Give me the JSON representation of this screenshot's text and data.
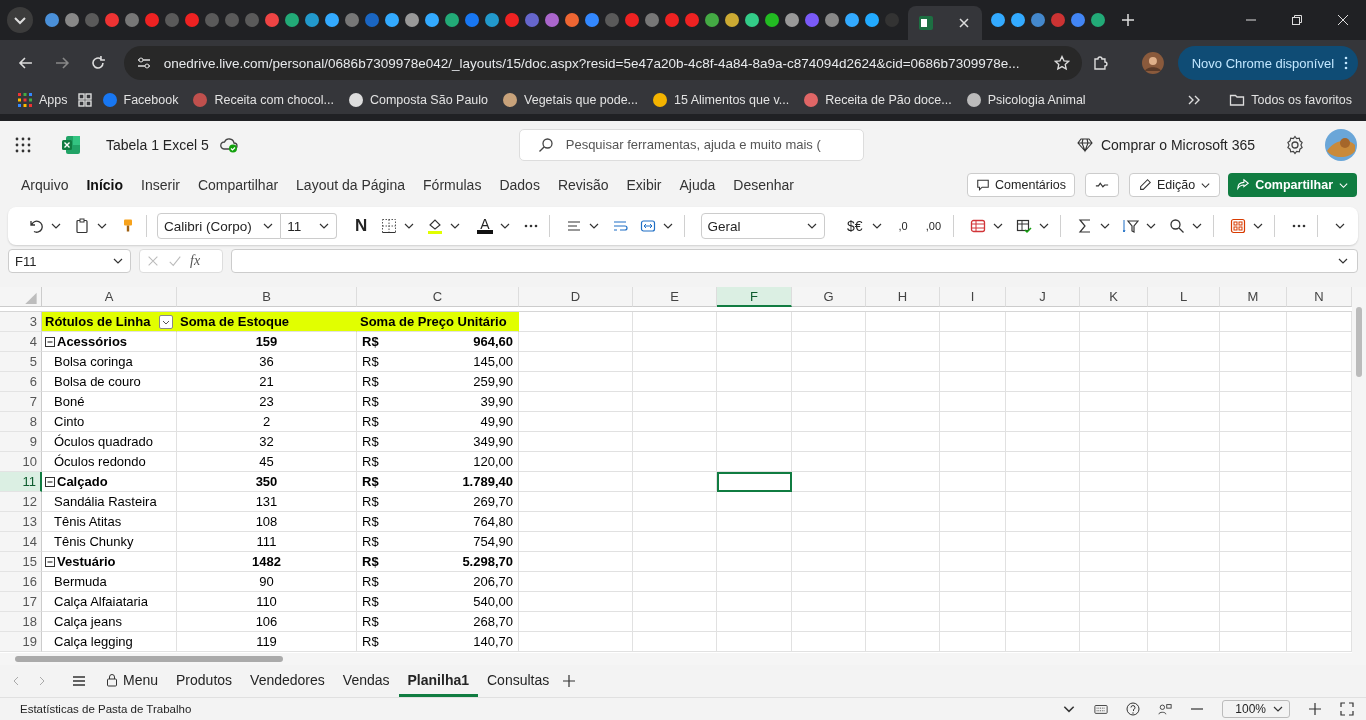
{
  "browser": {
    "address": "onedrive.live.com/personal/0686b7309978e042/_layouts/15/doc.aspx?resid=5e47a20b-4c8f-4a84-8a9a-c874094d2624&cid=0686b7309978e...",
    "update_button": "Novo Chrome disponível",
    "bookmarks": [
      {
        "label": "Facebook",
        "color": "#1877f2"
      },
      {
        "label": "Receita com chocol...",
        "color": "#c0504d"
      },
      {
        "label": "Composta São Paulo",
        "color": "#dddddd"
      },
      {
        "label": "Vegetais que pode...",
        "color": "#c8a27a"
      },
      {
        "label": "15 Alimentos que v...",
        "color": "#f4b400"
      },
      {
        "label": "Receita de Pão doce...",
        "color": "#e06666"
      },
      {
        "label": "Psicologia Animal",
        "color": "#bbbbbb"
      }
    ],
    "apps_label": "Apps",
    "all_bookmarks": "Todos os favoritos"
  },
  "app": {
    "title": "Tabela 1 Excel 5",
    "search_placeholder": "Pesquisar ferramentas, ajuda e muito mais (",
    "buy_label": "Comprar o Microsoft 365"
  },
  "menu": [
    {
      "label": "Arquivo",
      "selected": false
    },
    {
      "label": "Início",
      "selected": true
    },
    {
      "label": "Inserir",
      "selected": false
    },
    {
      "label": "Compartilhar",
      "selected": false
    },
    {
      "label": "Layout da Página",
      "selected": false
    },
    {
      "label": "Fórmulas",
      "selected": false
    },
    {
      "label": "Dados",
      "selected": false
    },
    {
      "label": "Revisão",
      "selected": false
    },
    {
      "label": "Exibir",
      "selected": false
    },
    {
      "label": "Ajuda",
      "selected": false
    },
    {
      "label": "Desenhar",
      "selected": false
    }
  ],
  "actions": {
    "comments": "Comentários",
    "editing": "Edição",
    "share": "Compartilhar"
  },
  "ribbon": {
    "font": "Calibri (Corpo)",
    "size": "11",
    "bold": "N",
    "font_color_letter": "A",
    "number_format": "Geral",
    "currency": "$€",
    "decrease_decimal": ",0",
    "increase_decimal": ",00"
  },
  "formula_bar": {
    "name_box": "F11",
    "function_label": "fx"
  },
  "sheet": {
    "columns": [
      {
        "label": "A",
        "selected": false
      },
      {
        "label": "B",
        "selected": false
      },
      {
        "label": "C",
        "selected": false
      },
      {
        "label": "D",
        "selected": false
      },
      {
        "label": "E",
        "selected": false
      },
      {
        "label": "F",
        "selected": true
      },
      {
        "label": "G",
        "selected": false
      },
      {
        "label": "H",
        "selected": false
      },
      {
        "label": "I",
        "selected": false
      },
      {
        "label": "J",
        "selected": false
      },
      {
        "label": "K",
        "selected": false
      },
      {
        "label": "L",
        "selected": false
      },
      {
        "label": "M",
        "selected": false
      },
      {
        "label": "N",
        "selected": false
      }
    ],
    "rows": [
      {
        "number": "3",
        "kind": "header",
        "selected": false,
        "label": "Rótulos de Linha",
        "stock": "Soma de Estoque",
        "price": "Soma de Preço Unitário"
      },
      {
        "number": "4",
        "kind": "group",
        "selected": false,
        "expanded": true,
        "label": "Acessórios",
        "stock": "159",
        "currency": "R$",
        "price": "964,60"
      },
      {
        "number": "5",
        "kind": "item",
        "selected": false,
        "label": "Bolsa coringa",
        "stock": "36",
        "currency": "R$",
        "price": "145,00"
      },
      {
        "number": "6",
        "kind": "item",
        "selected": false,
        "label": "Bolsa de couro",
        "stock": "21",
        "currency": "R$",
        "price": "259,90"
      },
      {
        "number": "7",
        "kind": "item",
        "selected": false,
        "label": "Boné",
        "stock": "23",
        "currency": "R$",
        "price": "39,90"
      },
      {
        "number": "8",
        "kind": "item",
        "selected": false,
        "label": "Cinto",
        "stock": "2",
        "currency": "R$",
        "price": "49,90"
      },
      {
        "number": "9",
        "kind": "item",
        "selected": false,
        "label": "Óculos quadrado",
        "stock": "32",
        "currency": "R$",
        "price": "349,90"
      },
      {
        "number": "10",
        "kind": "item",
        "selected": false,
        "label": "Óculos redondo",
        "stock": "45",
        "currency": "R$",
        "price": "120,00"
      },
      {
        "number": "11",
        "kind": "group",
        "selected": true,
        "expanded": true,
        "label": "Calçado",
        "stock": "350",
        "currency": "R$",
        "price": "1.789,40"
      },
      {
        "number": "12",
        "kind": "item",
        "selected": false,
        "label": "Sandália Rasteira",
        "stock": "131",
        "currency": "R$",
        "price": "269,70"
      },
      {
        "number": "13",
        "kind": "item",
        "selected": false,
        "label": "Tênis Atitas",
        "stock": "108",
        "currency": "R$",
        "price": "764,80"
      },
      {
        "number": "14",
        "kind": "item",
        "selected": false,
        "label": "Tênis Chunky",
        "stock": "111",
        "currency": "R$",
        "price": "754,90"
      },
      {
        "number": "15",
        "kind": "group",
        "selected": false,
        "expanded": true,
        "label": "Vestuário",
        "stock": "1482",
        "currency": "R$",
        "price": "5.298,70"
      },
      {
        "number": "16",
        "kind": "item",
        "selected": false,
        "label": "Bermuda",
        "stock": "90",
        "currency": "R$",
        "price": "206,70"
      },
      {
        "number": "17",
        "kind": "item",
        "selected": false,
        "label": "Calça Alfaiataria",
        "stock": "110",
        "currency": "R$",
        "price": "540,00"
      },
      {
        "number": "18",
        "kind": "item",
        "selected": false,
        "label": "Calça jeans",
        "stock": "106",
        "currency": "R$",
        "price": "268,70"
      },
      {
        "number": "19",
        "kind": "item",
        "selected": false,
        "label": "Calça legging",
        "stock": "119",
        "currency": "R$",
        "price": "140,70"
      }
    ]
  },
  "sheet_tabs": [
    {
      "label": "Menu",
      "kind": "locked",
      "selected": false
    },
    {
      "label": "Produtos",
      "kind": "sheet",
      "selected": false
    },
    {
      "label": "Vendedores",
      "kind": "sheet",
      "selected": false
    },
    {
      "label": "Vendas",
      "kind": "sheet",
      "selected": false
    },
    {
      "label": "Planilha1",
      "kind": "sheet",
      "selected": true
    },
    {
      "label": "Consultas",
      "kind": "sheet",
      "selected": false
    }
  ],
  "status": {
    "text": "Estatísticas de Pasta de Trabalho",
    "zoom": "100%"
  }
}
